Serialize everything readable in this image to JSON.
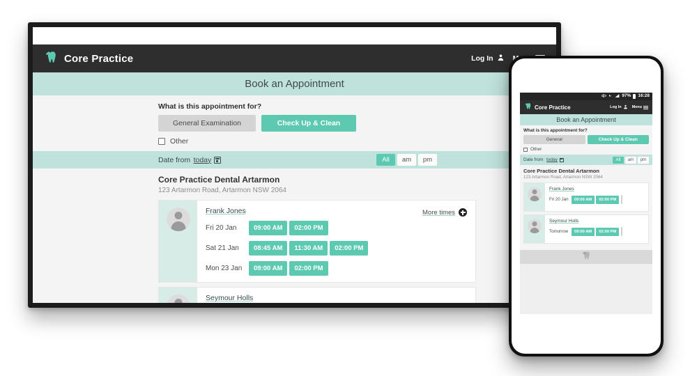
{
  "brand": {
    "name": "Core Practice",
    "logo_icon": "tooth-logo-icon"
  },
  "header": {
    "login_label": "Log In",
    "login_icon": "person-icon",
    "menu_label": "Menu",
    "menu_icon": "hamburger-icon"
  },
  "page": {
    "title": "Book an Appointment"
  },
  "appointment": {
    "question": "What is this appointment for?",
    "option_general": "General Examination",
    "option_checkup": "Check Up & Clean",
    "option_other": "Other",
    "checkbox_icon": "checkbox-icon"
  },
  "datefilter": {
    "label": "Date from",
    "value": "today",
    "calendar_icon": "calendar-icon",
    "filters": [
      {
        "label": "All",
        "selected": true
      },
      {
        "label": "am",
        "selected": false
      },
      {
        "label": "pm",
        "selected": false
      }
    ]
  },
  "practice": {
    "name": "Core Practice Dental Artarmon",
    "address": "123 Artarmon Road, Artarmon NSW 2064"
  },
  "practitioners": [
    {
      "name": "Frank Jones",
      "avatar_icon": "avatar-icon",
      "more_times_label": "More times",
      "more_times_icon": "plus-circle-icon",
      "days": [
        {
          "day": "Fri 20 Jan",
          "slots": [
            "09:00 AM",
            "02:00 PM"
          ]
        },
        {
          "day": "Sat 21 Jan",
          "slots": [
            "08:45 AM",
            "11:30 AM",
            "02:00 PM"
          ]
        },
        {
          "day": "Mon 23 Jan",
          "slots": [
            "09:00 AM",
            "02:00 PM"
          ]
        }
      ]
    },
    {
      "name": "Seymour Holls",
      "avatar_icon": "avatar-icon",
      "days": []
    }
  ],
  "mobile": {
    "status": {
      "mute_icon": "mute-icon",
      "roaming_icon": "roaming-icon",
      "signal_icon": "signal-bars-icon",
      "battery_percent": "97%",
      "battery_icon": "battery-icon",
      "clock": "16:28"
    },
    "page_title": "Book an Appointment",
    "question": "What is this appointment for?",
    "option_general": "General",
    "option_checkup": "Check Up & Clean",
    "option_other": "Other",
    "datefilter": {
      "label": "Date from",
      "value": "today",
      "filters": [
        {
          "label": "All",
          "selected": true
        },
        {
          "label": "am",
          "selected": false
        },
        {
          "label": "pm",
          "selected": false
        }
      ]
    },
    "practice": {
      "name": "Core Practice Dental Artarmon",
      "address": "123 Artarmon Road, Artarmon NSW 2064"
    },
    "practitioners": [
      {
        "name": "Frank Jones",
        "day": "Fri 20 Jan",
        "slots": [
          "09:00 AM",
          "02:00 PM"
        ]
      },
      {
        "name": "Seymour Holls",
        "day": "Tomorrow",
        "slots": [
          "09:00 AM",
          "02:00 PM"
        ]
      }
    ],
    "footer_icon": "tooth-watermark-icon"
  },
  "colors": {
    "accent": "#5cc9b0",
    "band": "#c0e2dc",
    "dark": "#2e2e2e",
    "page_bg": "#f4f4f4"
  }
}
